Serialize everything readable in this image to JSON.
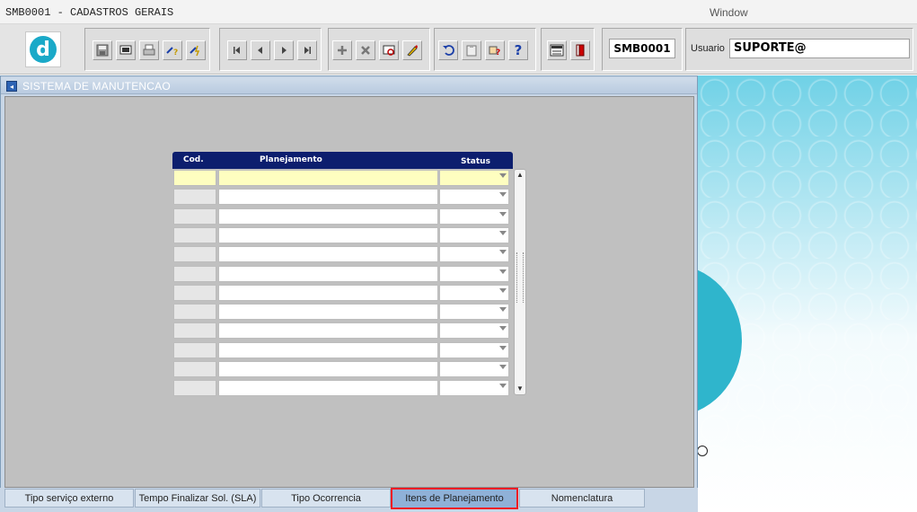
{
  "titlebar": {
    "title": "SMB0001 - CADASTROS GERAIS",
    "menu": "Window"
  },
  "toolbar": {
    "logo_letter": "d",
    "form_code": "SMB0001",
    "user_label": "Usuario",
    "user_value": "SUPORTE@",
    "groups": [
      {
        "icons": [
          "save-icon",
          "screen-icon",
          "print-icon",
          "query-icon",
          "execute-query-icon"
        ]
      },
      {
        "icons": [
          "first-record-icon",
          "previous-record-icon",
          "next-record-icon",
          "last-record-icon"
        ]
      },
      {
        "icons": [
          "insert-record-icon",
          "delete-record-icon",
          "find-icon",
          "edit-icon"
        ]
      },
      {
        "icons": [
          "undo-icon",
          "clipboard-icon",
          "help-hand-icon",
          "help-icon"
        ]
      },
      {
        "icons": [
          "menu-icon",
          "exit-icon"
        ]
      }
    ]
  },
  "window": {
    "title": "SISTEMA DE MANUTENCAO"
  },
  "grid": {
    "headers": {
      "cod": "Cod.",
      "planejamento": "Planejamento",
      "status": "Status"
    },
    "row_count": 12
  },
  "tabs": [
    {
      "label": "Tipo serviço externo",
      "selected": false
    },
    {
      "label": "Tempo Finalizar Sol. (SLA)",
      "selected": false
    },
    {
      "label": "Tipo Ocorrencia",
      "selected": false
    },
    {
      "label": "Itens de Planejamento",
      "selected": true
    },
    {
      "label": "Nomenclatura",
      "selected": false
    }
  ],
  "colors": {
    "grid_header": "#0c1e6e",
    "active_row": "#fefec0",
    "selected_tab_border": "#ee1c24",
    "brand_logo": "#1aa9c8"
  }
}
